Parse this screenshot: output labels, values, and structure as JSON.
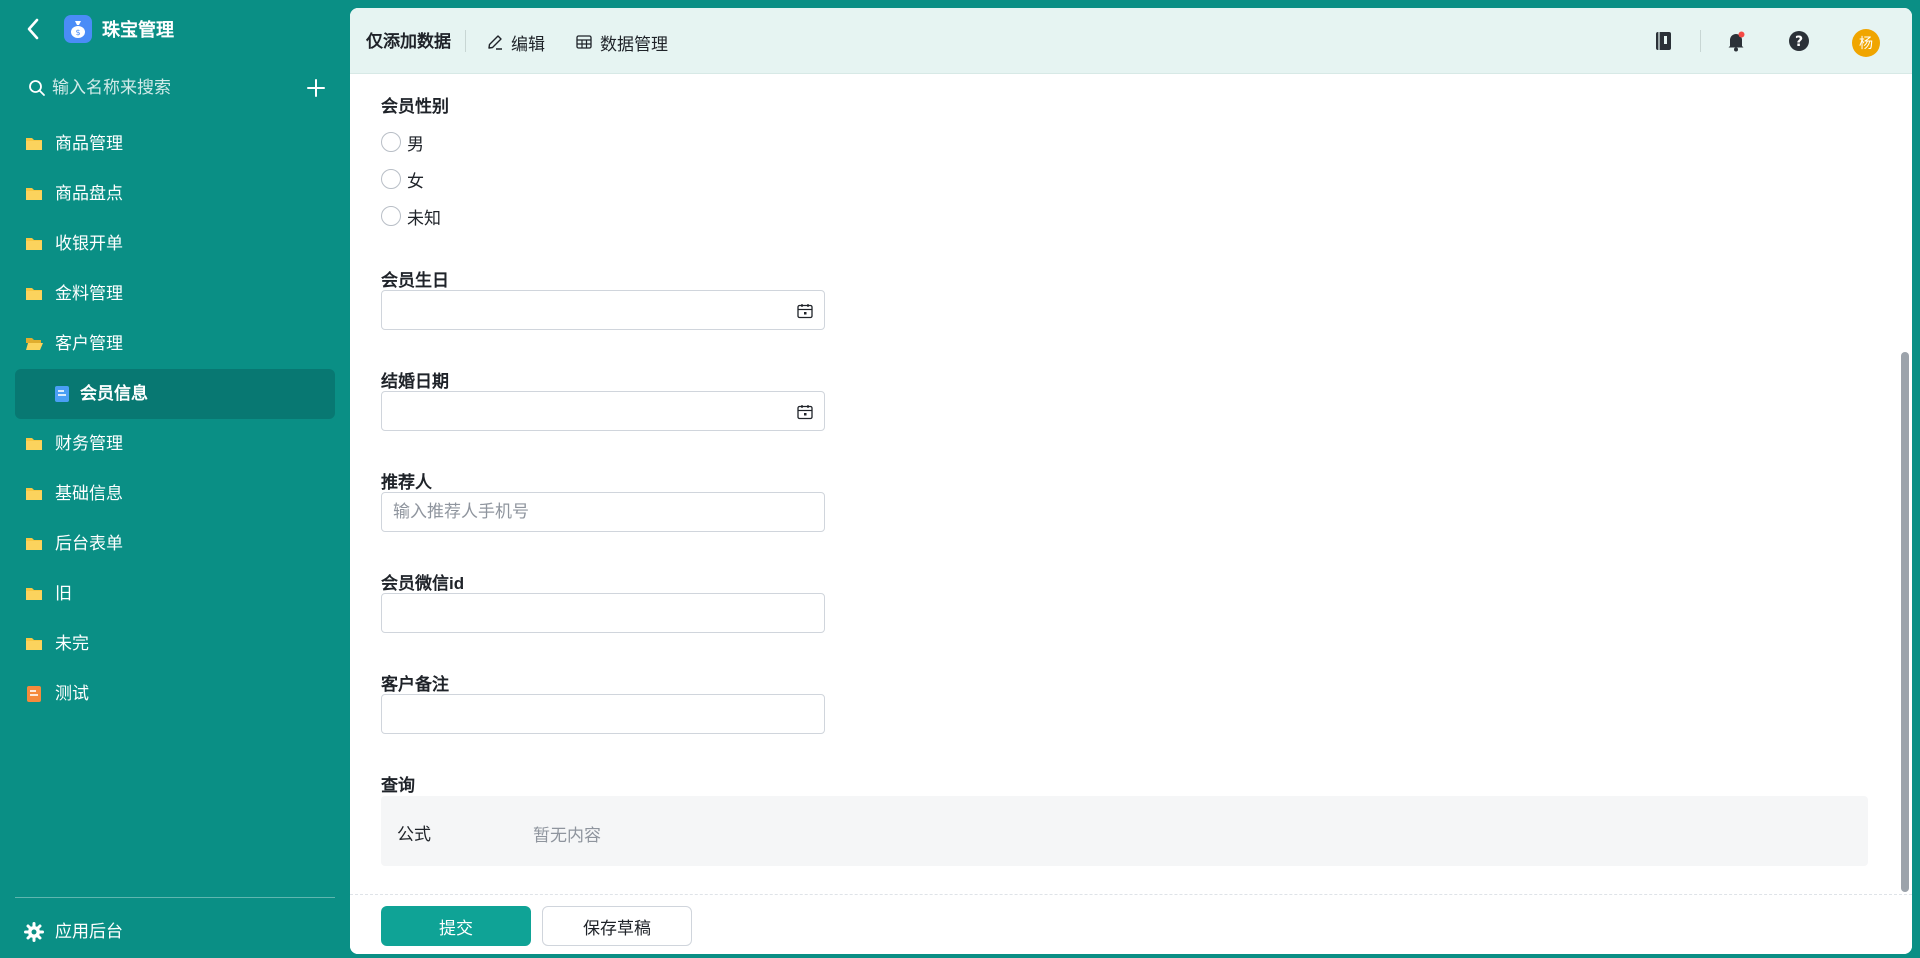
{
  "sidebar": {
    "app_title": "珠宝管理",
    "search_placeholder": "输入名称来搜索",
    "items": [
      {
        "label": "商品管理",
        "icon": "folder-icon"
      },
      {
        "label": "商品盘点",
        "icon": "folder-icon"
      },
      {
        "label": "收银开单",
        "icon": "folder-icon"
      },
      {
        "label": "金料管理",
        "icon": "folder-icon"
      },
      {
        "label": "客户管理",
        "icon": "folder-open-icon"
      },
      {
        "label": "会员信息",
        "icon": "form-icon",
        "selected": true
      },
      {
        "label": "财务管理",
        "icon": "folder-icon"
      },
      {
        "label": "基础信息",
        "icon": "folder-icon"
      },
      {
        "label": "后台表单",
        "icon": "folder-icon"
      },
      {
        "label": "旧",
        "icon": "folder-icon"
      },
      {
        "label": "未完",
        "icon": "folder-icon"
      },
      {
        "label": "测试",
        "icon": "form-orange-icon"
      }
    ],
    "footer_label": "应用后台"
  },
  "topbar": {
    "title": "仅添加数据",
    "edit_label": "编辑",
    "data_manage_label": "数据管理",
    "avatar_text": "杨"
  },
  "form": {
    "gender": {
      "label": "会员性别",
      "options": [
        "男",
        "女",
        "未知"
      ]
    },
    "birthday": {
      "label": "会员生日",
      "value": ""
    },
    "wedding_date": {
      "label": "结婚日期",
      "value": ""
    },
    "referrer": {
      "label": "推荐人",
      "placeholder": "输入推荐人手机号",
      "value": ""
    },
    "wechat_id": {
      "label": "会员微信id",
      "value": ""
    },
    "remark": {
      "label": "客户备注",
      "value": ""
    },
    "query": {
      "label": "查询",
      "key": "公式",
      "value": "暂无内容"
    }
  },
  "footer": {
    "submit_label": "提交",
    "save_draft_label": "保存草稿"
  },
  "colors": {
    "sidebar_bg": "#0a8f85",
    "selected_bg": "#087872",
    "primary": "#0fa396",
    "avatar": "#f0a500",
    "folder": "#f7c744"
  }
}
